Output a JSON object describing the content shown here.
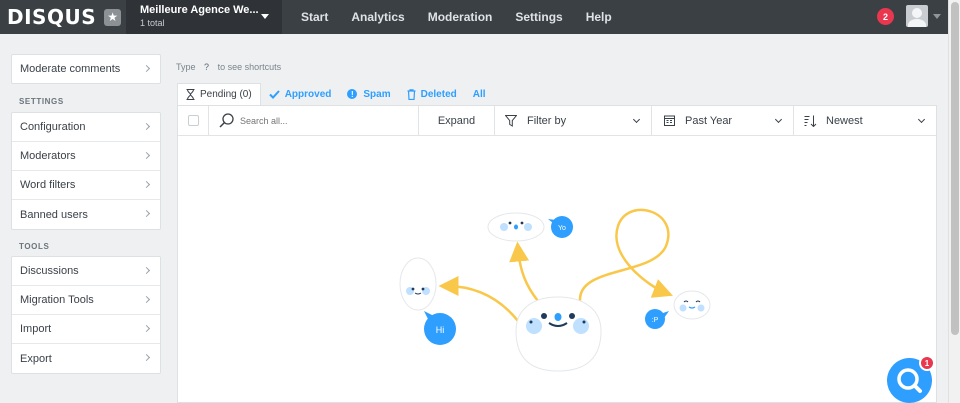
{
  "brand": {
    "name": "DISQUS",
    "star": "★"
  },
  "site": {
    "name": "Meilleure Agence We...",
    "count": "1 total"
  },
  "nav": [
    "Start",
    "Analytics",
    "Moderation",
    "Settings",
    "Help"
  ],
  "notifications": {
    "count": "2"
  },
  "sidebar": {
    "moderate": "Moderate comments",
    "settings_heading": "SETTINGS",
    "settings": [
      "Configuration",
      "Moderators",
      "Word filters",
      "Banned users"
    ],
    "tools_heading": "TOOLS",
    "tools": [
      "Discussions",
      "Migration Tools",
      "Import",
      "Export"
    ]
  },
  "shortcuts": {
    "prefix": "Type",
    "key": "?",
    "suffix": "to see shortcuts"
  },
  "tabs": {
    "pending": "Pending (0)",
    "approved": "Approved",
    "spam": "Spam",
    "deleted": "Deleted",
    "all": "All"
  },
  "toolbar": {
    "search_placeholder": "Search all...",
    "expand": "Expand",
    "filter": "Filter by",
    "period": "Past Year",
    "sort": "Newest"
  },
  "illustration": {
    "bubble_hi": "Hi",
    "bubble_yo": "Yo",
    "bubble_p": ":P"
  },
  "chat": {
    "badge": "1"
  },
  "colors": {
    "accent": "#2e9fff",
    "topbar": "#3b4045",
    "badge": "#e8374f",
    "arrow": "#f9c84a"
  }
}
